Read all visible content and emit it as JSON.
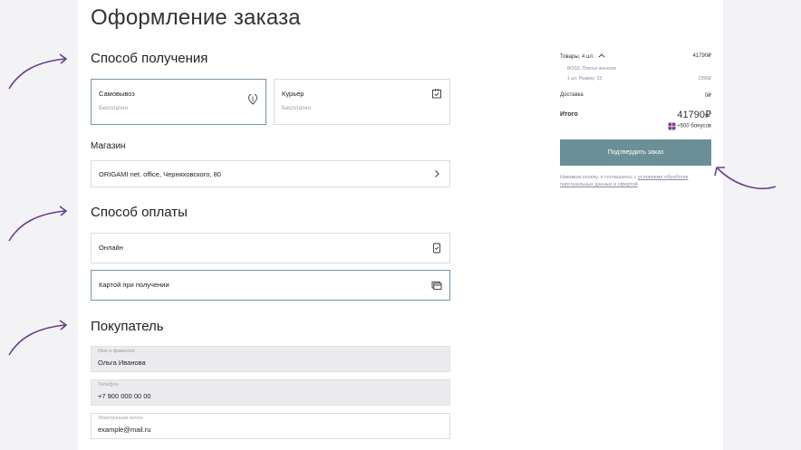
{
  "page": {
    "title": "Оформление заказа"
  },
  "delivery": {
    "heading": "Способ получения",
    "options": [
      {
        "title": "Самовывоз",
        "sub": "Бесплатно",
        "icon": "map-pin-icon",
        "selected": true
      },
      {
        "title": "Курьер",
        "sub": "Бесплатно",
        "icon": "package-icon",
        "selected": false
      }
    ]
  },
  "store": {
    "heading": "Магазин",
    "value": "ORIGAMI net. office, Черняховского, 80"
  },
  "payment": {
    "heading": "Способ оплаты",
    "options": [
      {
        "title": "Онлайн",
        "icon": "phone-check-icon",
        "selected": false
      },
      {
        "title": "Картой при получении",
        "icon": "card-icon",
        "selected": true
      }
    ]
  },
  "buyer": {
    "heading": "Покупатель",
    "fields": [
      {
        "label": "Имя и фамилия",
        "value": "Ольга Иванова",
        "filled": true
      },
      {
        "label": "Телефон",
        "value": "+7 900 000 00 00",
        "filled": true
      },
      {
        "label": "Электронная почта",
        "value": "example@mail.ru",
        "filled": false
      }
    ]
  },
  "summary": {
    "items_label": "Товары, 4 шт.",
    "items_total": "41790₽",
    "item_name": "BOSS, Платье женское",
    "item_detail": "1 шт. Размер: 32",
    "item_price": "2390₽",
    "delivery_label": "Доставка",
    "delivery_value": "0₽",
    "total_label": "Итого",
    "total_value": "41790₽",
    "bonus": "+500 бонусов",
    "confirm_label": "Подтвердить заказ",
    "note_prefix": "Нажимая кнопку, я соглашаюсь с ",
    "note_link": "условиями обработки персональных данных и офертой",
    "note_suffix": "."
  },
  "colors": {
    "accent": "#6b8f96",
    "arrow": "#6a3d8f",
    "selected_border": "#7a95a4"
  }
}
